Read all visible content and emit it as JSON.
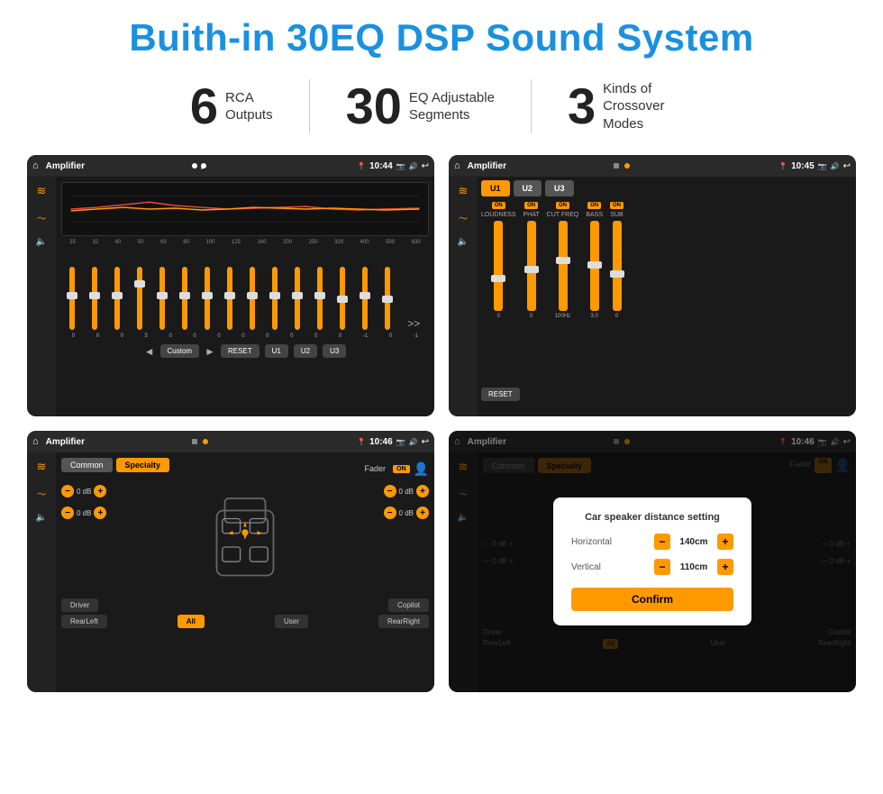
{
  "header": {
    "title": "Buith-in 30EQ DSP Sound System"
  },
  "stats": [
    {
      "number": "6",
      "text": "RCA\nOutputs"
    },
    {
      "number": "30",
      "text": "EQ Adjustable\nSegments"
    },
    {
      "number": "3",
      "text": "Kinds of\nCrossover Modes"
    }
  ],
  "screens": [
    {
      "id": "screen1",
      "time": "10:44",
      "app": "Amplifier",
      "type": "eq",
      "freqs": [
        "25",
        "32",
        "40",
        "50",
        "63",
        "80",
        "100",
        "125",
        "160",
        "200",
        "250",
        "320",
        "400",
        "500",
        "630"
      ],
      "values": [
        "0",
        "0",
        "0",
        "5",
        "0",
        "0",
        "0",
        "0",
        "0",
        "0",
        "0",
        "0",
        "-1",
        "0",
        "-1"
      ],
      "preset": "Custom",
      "buttons": [
        "RESET",
        "U1",
        "U2",
        "U3"
      ]
    },
    {
      "id": "screen2",
      "time": "10:45",
      "app": "Amplifier",
      "type": "crossover",
      "presets": [
        "U1",
        "U2",
        "U3"
      ],
      "channels": [
        "LOUDNESS",
        "PHAT",
        "CUT FREQ",
        "BASS",
        "SUB"
      ],
      "reset": "RESET"
    },
    {
      "id": "screen3",
      "time": "10:46",
      "app": "Amplifier",
      "type": "fader",
      "tabs": [
        "Common",
        "Specialty"
      ],
      "activeTab": "Specialty",
      "faderLabel": "Fader",
      "faderOn": "ON",
      "dbValues": [
        "0 dB",
        "0 dB",
        "0 dB",
        "0 dB"
      ],
      "bottomButtons": [
        "Driver",
        "RearLeft",
        "All",
        "User",
        "Copilot",
        "RearRight"
      ]
    },
    {
      "id": "screen4",
      "time": "10:46",
      "app": "Amplifier",
      "type": "distance",
      "tabs": [
        "Common",
        "Specialty"
      ],
      "activeTab": "Specialty",
      "faderOn": "ON",
      "dialog": {
        "title": "Car speaker distance setting",
        "horizontal": {
          "label": "Horizontal",
          "value": "140cm"
        },
        "vertical": {
          "label": "Vertical",
          "value": "110cm"
        },
        "confirm": "Confirm"
      },
      "dbValues": [
        "0 dB",
        "0 dB"
      ],
      "bottomButtons": [
        "Driver",
        "RearLeft",
        "All",
        "User",
        "Copilot",
        "RearRight"
      ]
    }
  ]
}
